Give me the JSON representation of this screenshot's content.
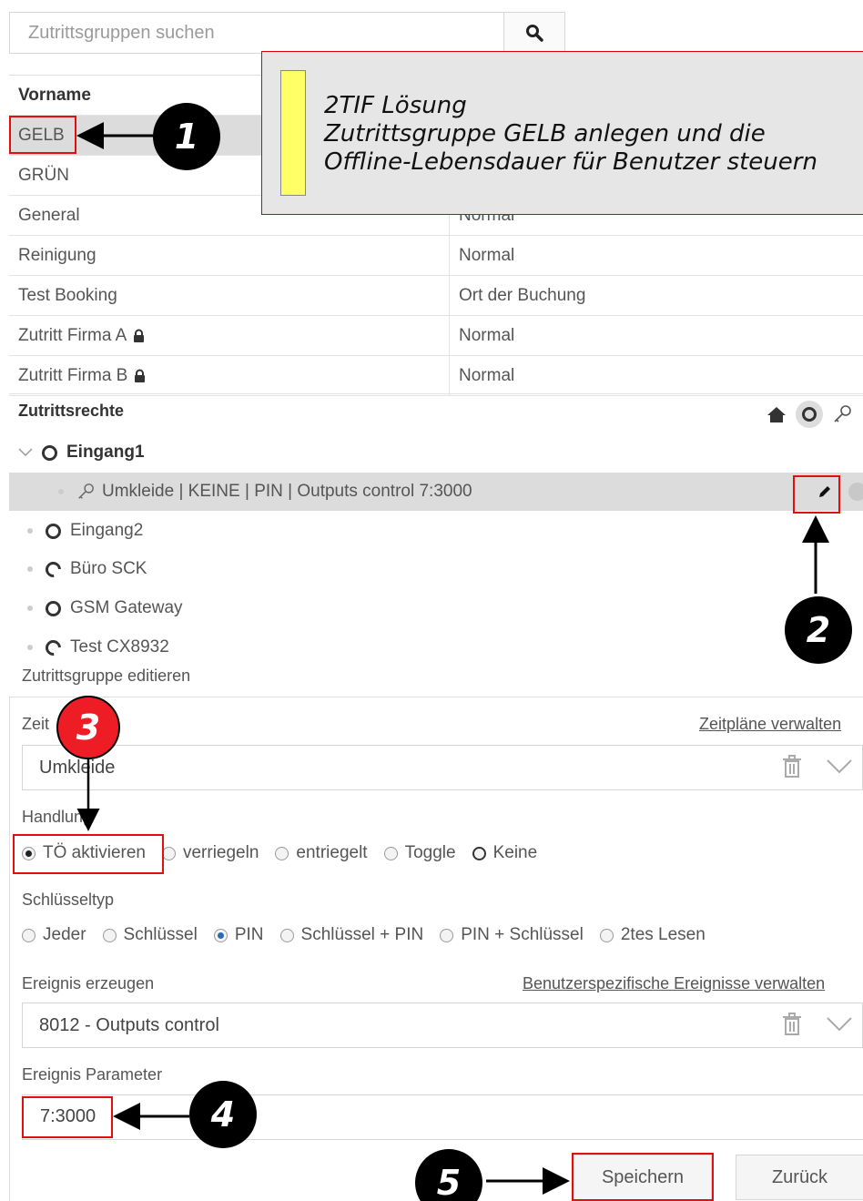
{
  "search": {
    "placeholder": "Zutrittsgruppen suchen"
  },
  "groups_table": {
    "header": "Vorname",
    "rows": [
      {
        "name": "GELB",
        "mode": ""
      },
      {
        "name": "GRÜN",
        "mode": ""
      },
      {
        "name": "General",
        "mode": "Normal"
      },
      {
        "name": "Reinigung",
        "mode": "Normal"
      },
      {
        "name": "Test Booking",
        "mode": "Ort der Buchung"
      },
      {
        "name": "Zutritt Firma A",
        "mode": "Normal"
      },
      {
        "name": "Zutritt Firma B",
        "mode": "Normal"
      }
    ]
  },
  "rights": {
    "title": "Zutrittsrechte",
    "tree": [
      {
        "label": "Eingang1"
      },
      {
        "label": "Umkleide | KEINE | PIN | Outputs control 7:3000"
      },
      {
        "label": "Eingang2"
      },
      {
        "label": "Büro SCK"
      },
      {
        "label": "GSM Gateway"
      },
      {
        "label": "Test CX8932"
      }
    ]
  },
  "edit": {
    "title": "Zutrittsgruppe editieren",
    "zeitplan_label": "Zeit",
    "zeitplan_link": "Zeitpläne verwalten",
    "zeitplan_value": "Umkleide",
    "handlung_label": "Handlung",
    "handlung_options": [
      "TÖ aktivieren",
      "verriegeln",
      "entriegelt",
      "Toggle",
      "Keine"
    ],
    "schluessel_label": "Schlüsseltyp",
    "schluessel_options": [
      "Jeder",
      "Schlüssel",
      "PIN",
      "Schlüssel + PIN",
      "PIN + Schlüssel",
      "2tes Lesen"
    ],
    "ereignis_label": "Ereignis erzeugen",
    "ereignis_link": "Benutzerspezifische Ereignisse verwalten",
    "ereignis_value": "8012 - Outputs control",
    "param_label": "Ereignis Parameter",
    "param_value": "7:3000",
    "save_label": "Speichern",
    "back_label": "Zurück"
  },
  "annotations": {
    "callout_lines": [
      "2TIF Lösung",
      "Zutrittsgruppe GELB anlegen und die",
      "Offline-Lebensdauer für Benutzer steuern"
    ],
    "badges": [
      "1",
      "2",
      "3",
      "4",
      "5"
    ],
    "highlight_color": "#e01010",
    "note_color": "#ffff66"
  }
}
